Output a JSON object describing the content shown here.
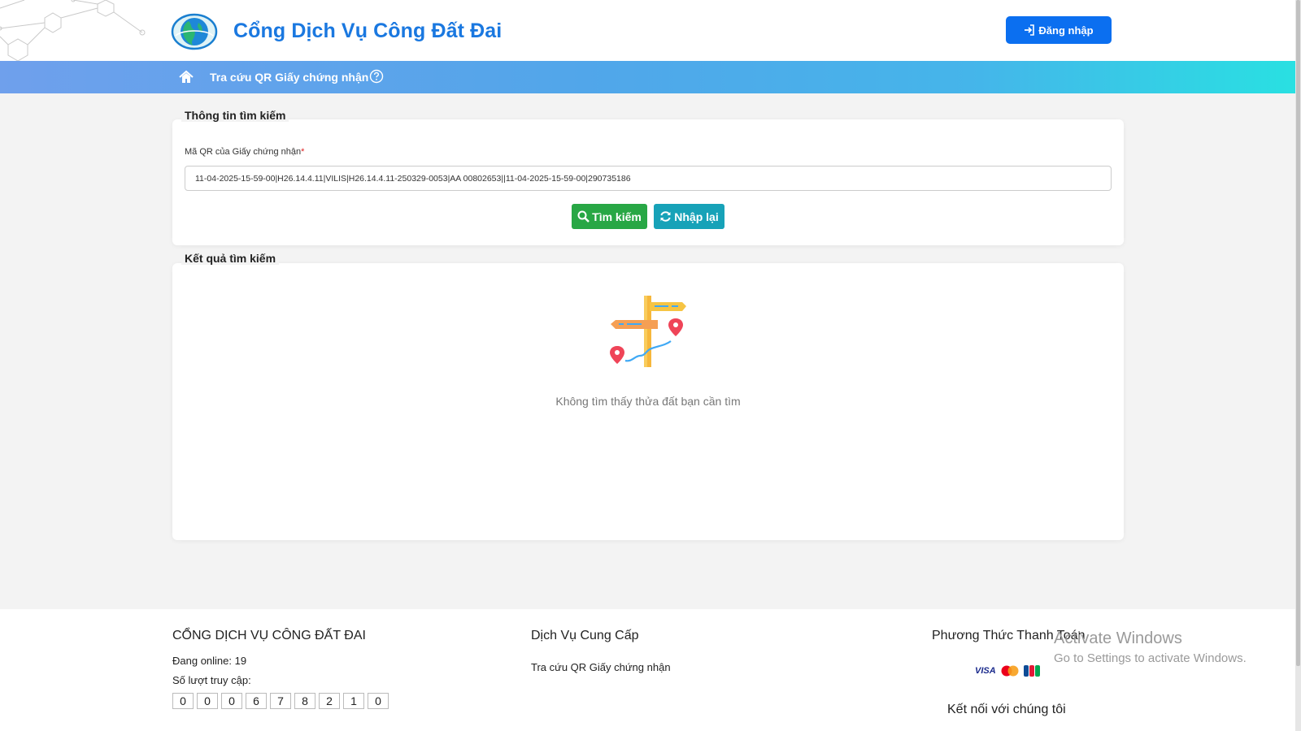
{
  "header": {
    "brand": "Cổng Dịch Vụ Công Đất Đai",
    "login_label": "Đăng nhập"
  },
  "nav": {
    "link": "Tra cứu QR Giấy chứng nhận"
  },
  "search": {
    "legend": "Thông tin tìm kiếm",
    "field_label": "Mã QR của Giấy chứng nhận",
    "required_mark": "*",
    "qr_value": "11-04-2025-15-59-00|H26.14.4.11|VILIS|H26.14.4.11-250329-0053|AA 00802653||11-04-2025-15-59-00|290735186",
    "search_label": "Tìm kiếm",
    "reset_label": "Nhập lại"
  },
  "result": {
    "legend": "Kết quả tìm kiếm",
    "empty_text": "Không tìm thấy thửa đất bạn cần tìm"
  },
  "footer": {
    "col1_title": "CỔNG DỊCH VỤ CÔNG ĐẤT ĐAI",
    "online_text": "Đang online: 19",
    "visits_label": "Số lượt truy cập:",
    "visit_digits": [
      "0",
      "0",
      "0",
      "6",
      "7",
      "8",
      "2",
      "1",
      "0"
    ],
    "col2_title": "Dịch Vụ Cung Cấp",
    "col2_link": "Tra cứu QR Giấy chứng nhận",
    "col3_title": "Phương Thức Thanh Toán",
    "visa_label": "VISA",
    "connect_title": "Kết nối với chúng tôi"
  },
  "watermark": {
    "line1": "Activate Windows",
    "line2": "Go to Settings to activate Windows."
  },
  "colors": {
    "brand_blue": "#1a78e0",
    "login_blue": "#0b6ff0",
    "search_green": "#28a745",
    "reset_teal": "#17a2b8"
  },
  "icons": {
    "nav_home": "home-icon",
    "nav_help": "question-circle-icon",
    "login": "sign-in-icon",
    "search": "search-icon",
    "reset": "refresh-icon",
    "empty": "signpost-map-pin-illustration"
  }
}
